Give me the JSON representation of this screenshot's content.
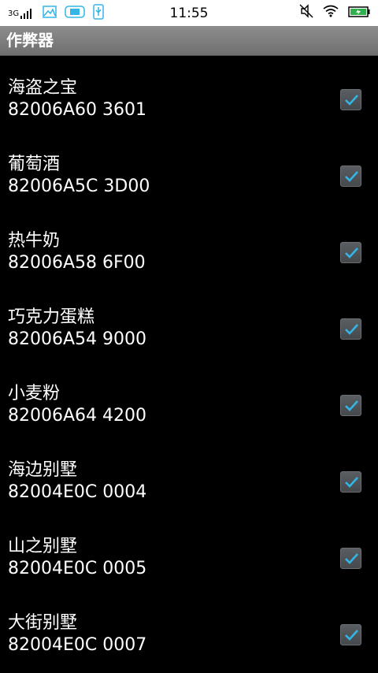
{
  "status_bar": {
    "network_type": "3G",
    "time": "11:55"
  },
  "header": {
    "title": "作弊器"
  },
  "cheats": [
    {
      "name": "海盗之宝",
      "code": "82006A60 3601",
      "checked": true
    },
    {
      "name": "葡萄酒",
      "code": "82006A5C 3D00",
      "checked": true
    },
    {
      "name": "热牛奶",
      "code": "82006A58 6F00",
      "checked": true
    },
    {
      "name": "巧克力蛋糕",
      "code": "82006A54 9000",
      "checked": true
    },
    {
      "name": "小麦粉",
      "code": "82006A64 4200",
      "checked": true
    },
    {
      "name": "海边别墅",
      "code": "82004E0C 0004",
      "checked": true
    },
    {
      "name": "山之别墅",
      "code": "82004E0C 0005",
      "checked": true
    },
    {
      "name": "大街别墅",
      "code": "82004E0C 0007",
      "checked": true
    }
  ],
  "colors": {
    "background": "#000000",
    "header_bg": "#7e7e7e",
    "checkmark": "#33b5e5",
    "text": "#ffffff"
  },
  "icons": {
    "status_left": [
      "signal-bars-icon",
      "gallery-icon",
      "game-icon",
      "usb-icon"
    ],
    "status_right": [
      "mute-icon",
      "wifi-icon",
      "battery-charging-icon"
    ],
    "row_control": "checkmark-icon"
  }
}
